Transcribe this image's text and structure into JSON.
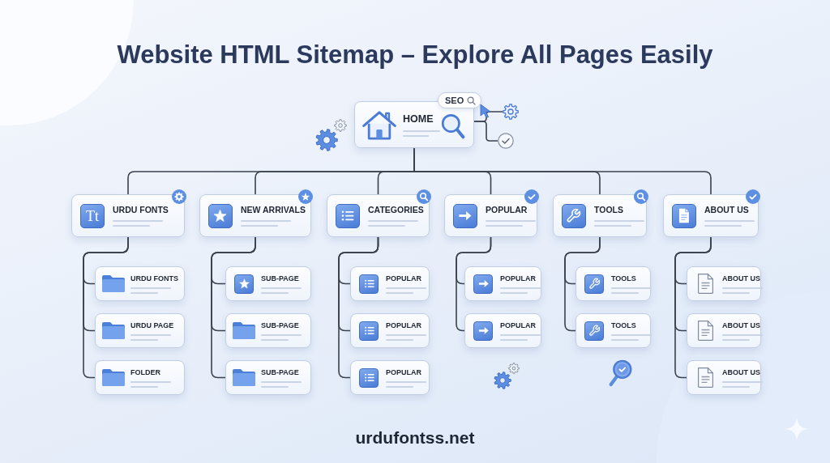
{
  "title": "Website HTML Sitemap – Explore All Pages Easily",
  "home": {
    "label": "HOME",
    "tag": "SEO"
  },
  "sections": [
    {
      "label": "URDU FONTS",
      "kind": "font",
      "glyph": "Tt",
      "badge": {
        "kind": "gear"
      },
      "children": [
        {
          "label": "URDU FONTS",
          "kind": "folder"
        },
        {
          "label": "URDU PAGE",
          "kind": "folder"
        },
        {
          "label": "FOLDER",
          "kind": "folder"
        }
      ]
    },
    {
      "label": "NEW ARRIVALS",
      "kind": "star",
      "badge": {
        "kind": "star"
      },
      "children": [
        {
          "label": "SUB-PAGE",
          "kind": "star"
        },
        {
          "label": "SUB-PAGE",
          "kind": "folder"
        },
        {
          "label": "SUB-PAGE",
          "kind": "folder"
        }
      ]
    },
    {
      "label": "CATEGORIES",
      "kind": "list",
      "badge": {
        "kind": "search"
      },
      "children": [
        {
          "label": "POPULAR",
          "kind": "list"
        },
        {
          "label": "POPULAR",
          "kind": "list"
        },
        {
          "label": "POPULAR",
          "kind": "list"
        }
      ]
    },
    {
      "label": "POPULAR",
      "kind": "arrow",
      "badge": {
        "kind": "check"
      },
      "children": [
        {
          "label": "POPULAR",
          "kind": "arrow"
        },
        {
          "label": "POPULAR",
          "kind": "arrow"
        }
      ]
    },
    {
      "label": "TOOLS",
      "kind": "wrench",
      "badge": {
        "kind": "search"
      },
      "children": [
        {
          "label": "TOOLS",
          "kind": "wrench"
        },
        {
          "label": "TOOLS",
          "kind": "wrench"
        }
      ]
    },
    {
      "label": "ABOUT US",
      "kind": "document",
      "badge": {
        "kind": "check"
      },
      "children": [
        {
          "label": "ABOUT US",
          "kind": "document"
        },
        {
          "label": "ABOUT US",
          "kind": "document"
        },
        {
          "label": "ABOUT US",
          "kind": "document"
        }
      ]
    }
  ],
  "footer": "urdufontss.net"
}
